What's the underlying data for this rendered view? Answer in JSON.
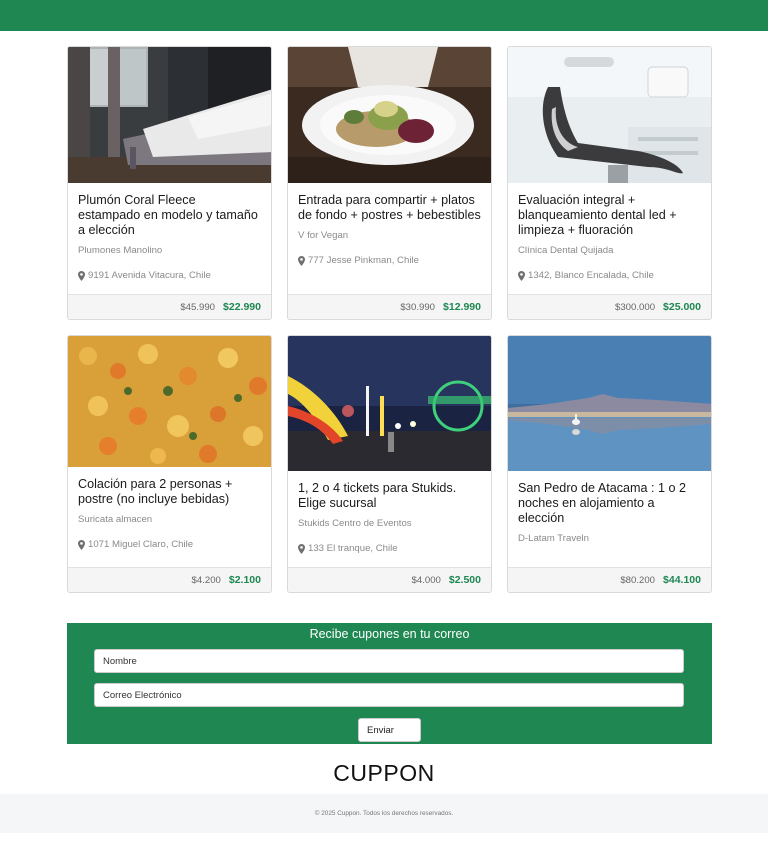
{
  "deals": [
    {
      "title": "Plumón Coral Fleece estampado en modelo y tamaño a elección",
      "vendor": "Plumones Manolino",
      "location": "9191 Avenida Vitacura, Chile",
      "old_price": "$45.990",
      "new_price": "$22.990",
      "image": "bedroom-photo"
    },
    {
      "title": "Entrada para compartir + platos de fondo + postres + bebestibles",
      "vendor": "V for Vegan",
      "location": "777 Jesse Pinkman, Chile",
      "old_price": "$30.990",
      "new_price": "$12.990",
      "image": "vegan-plate-photo"
    },
    {
      "title": "Evaluación integral + blanqueamiento dental led + limpieza + fluoración",
      "vendor": "Clínica Dental Quijada",
      "location": "1342, Blanco Encalada, Chile",
      "old_price": "$300.000",
      "new_price": "$25.000",
      "image": "dental-chair-photo"
    },
    {
      "title": "Colación para 2 personas + postre (no incluye bebidas)",
      "vendor": "Suricata almacen",
      "location": "1071 Miguel Claro, Chile",
      "old_price": "$4.200",
      "new_price": "$2.100",
      "image": "stew-photo"
    },
    {
      "title": "1, 2 o 4 tickets para Stukids. Elige sucursal",
      "vendor": "Stukids Centro de Eventos",
      "location": "133 El tranque, Chile",
      "old_price": "$4.000",
      "new_price": "$2.500",
      "image": "amusement-park-photo"
    },
    {
      "title": "San Pedro de Atacama : 1 o 2 noches en alojamiento a elección",
      "vendor": "D-Latam Traveln",
      "location": "",
      "old_price": "$80.200",
      "new_price": "$44.100",
      "image": "atacama-lagoon-photo"
    }
  ],
  "newsletter": {
    "title": "Recibe cupones en tu correo",
    "name_placeholder": "Nombre",
    "email_placeholder": "Correo Electrónico",
    "submit_label": "Enviar"
  },
  "brand": "CUPPON",
  "footer": {
    "copyright": "© 2025 Cuppon. Todos los derechos reservados."
  },
  "colors": {
    "brand_green": "#1f8752",
    "footer_bg": "#f5f6f8"
  },
  "icons": {
    "location": "map-pin-icon"
  }
}
